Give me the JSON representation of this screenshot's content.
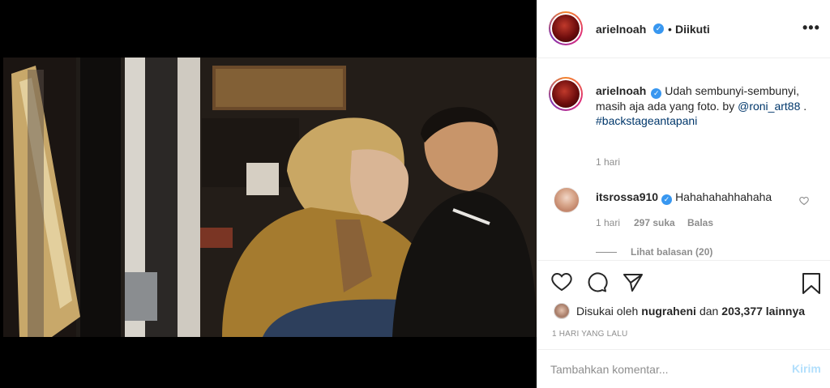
{
  "post": {
    "username": "arielnoah",
    "follow_separator": "•",
    "follow_status": "Diikuti",
    "more_icon": "more-icon",
    "caption_username": "arielnoah",
    "caption_text": "Udah sembunyi-sembunyi, masih aja ada yang foto. by ",
    "caption_mention": "@roni_art88",
    "caption_suffix": " .",
    "caption_hashtag": "#backstageantapani",
    "caption_time": "1 hari"
  },
  "comments": [
    {
      "username": "itsrossa910",
      "text": "Hahahahahhahaha",
      "time": "1 hari",
      "likes": "297 suka",
      "reply_label": "Balas",
      "view_replies": "Lihat balasan (20)"
    }
  ],
  "actions": {
    "like_icon": "heart-icon",
    "comment_icon": "comment-icon",
    "share_icon": "share-icon",
    "save_icon": "bookmark-icon"
  },
  "likes": {
    "prefix": "Disukai oleh",
    "user": "nugraheni",
    "conjunction": "dan",
    "count": "203,377 lainnya"
  },
  "date": "1 HARI YANG LALU",
  "add_comment": {
    "placeholder": "Tambahkan komentar...",
    "post_label": "Kirim"
  },
  "colors": {
    "link": "#00376b",
    "verified": "#3897f0",
    "post_button_disabled": "#b2dffc",
    "secondary_text": "#8e8e8e"
  }
}
